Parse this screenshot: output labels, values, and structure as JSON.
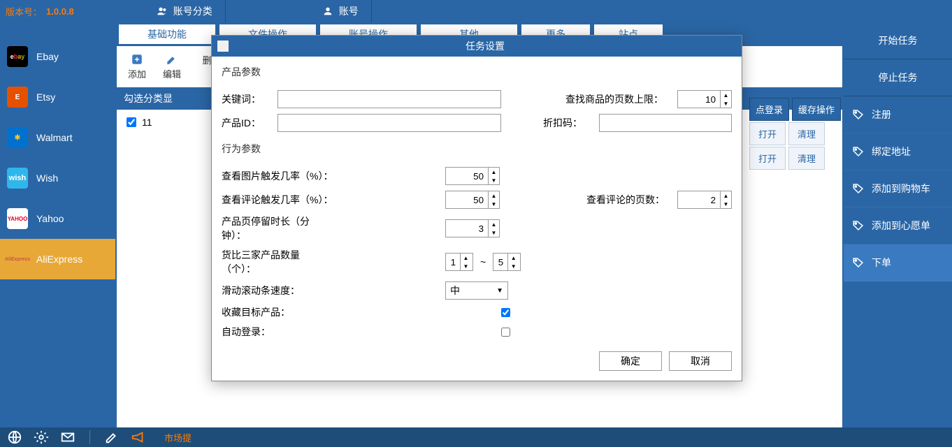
{
  "version": {
    "label": "版本号：",
    "value": "1.0.0.8"
  },
  "topTabs": {
    "category": "账号分类",
    "account": "账号"
  },
  "platforms": [
    {
      "name": "Ebay"
    },
    {
      "name": "Etsy"
    },
    {
      "name": "Walmart"
    },
    {
      "name": "Wish"
    },
    {
      "name": "Yahoo"
    },
    {
      "name": "AliExpress"
    }
  ],
  "centerTabs": {
    "basic": "基础功能",
    "file": "文件操作",
    "account": "账号操作",
    "other": "其他",
    "more": "更多",
    "site": "站点"
  },
  "toolbar": {
    "add": "添加",
    "edit": "编辑",
    "delete": "删"
  },
  "categoryHeader": "勾选分类显",
  "listItem": "11",
  "tableHeaders": {
    "siteLogin": "点登录",
    "cacheOp": "缓存操作"
  },
  "tableCells": {
    "open": "打开",
    "clear": "清理"
  },
  "rightSidebar": {
    "start": "开始任务",
    "stop": "停止任务",
    "register": "注册",
    "bindAddress": "绑定地址",
    "addToCart": "添加到购物车",
    "addToWish": "添加到心愿单",
    "order": "下单"
  },
  "modal": {
    "title": "任务设置",
    "productParams": "产品参数",
    "keyword": "关键词：",
    "maxPages": "查找商品的页数上限：",
    "maxPagesVal": "10",
    "productId": "产品ID：",
    "discountCode": "折扣码：",
    "behaviorParams": "行为参数",
    "imageTrigger": "查看图片触发几率（%）：",
    "imageTriggerVal": "50",
    "reviewTrigger": "查看评论触发几率（%）：",
    "reviewTriggerVal": "50",
    "reviewPages": "查看评论的页数：",
    "reviewPagesVal": "2",
    "stayDuration": "产品页停留时长（分钟）：",
    "stayDurationVal": "3",
    "compareCount": "货比三家产品数量（个）：",
    "compareMin": "1",
    "compareSep": "~",
    "compareMax": "5",
    "scrollSpeed": "滑动滚动条速度：",
    "scrollSpeedVal": "中",
    "favoriteTarget": "收藏目标产品：",
    "autoLogin": "自动登录：",
    "ok": "确定",
    "cancel": "取消"
  },
  "bottom": {
    "notice": "市场提"
  }
}
